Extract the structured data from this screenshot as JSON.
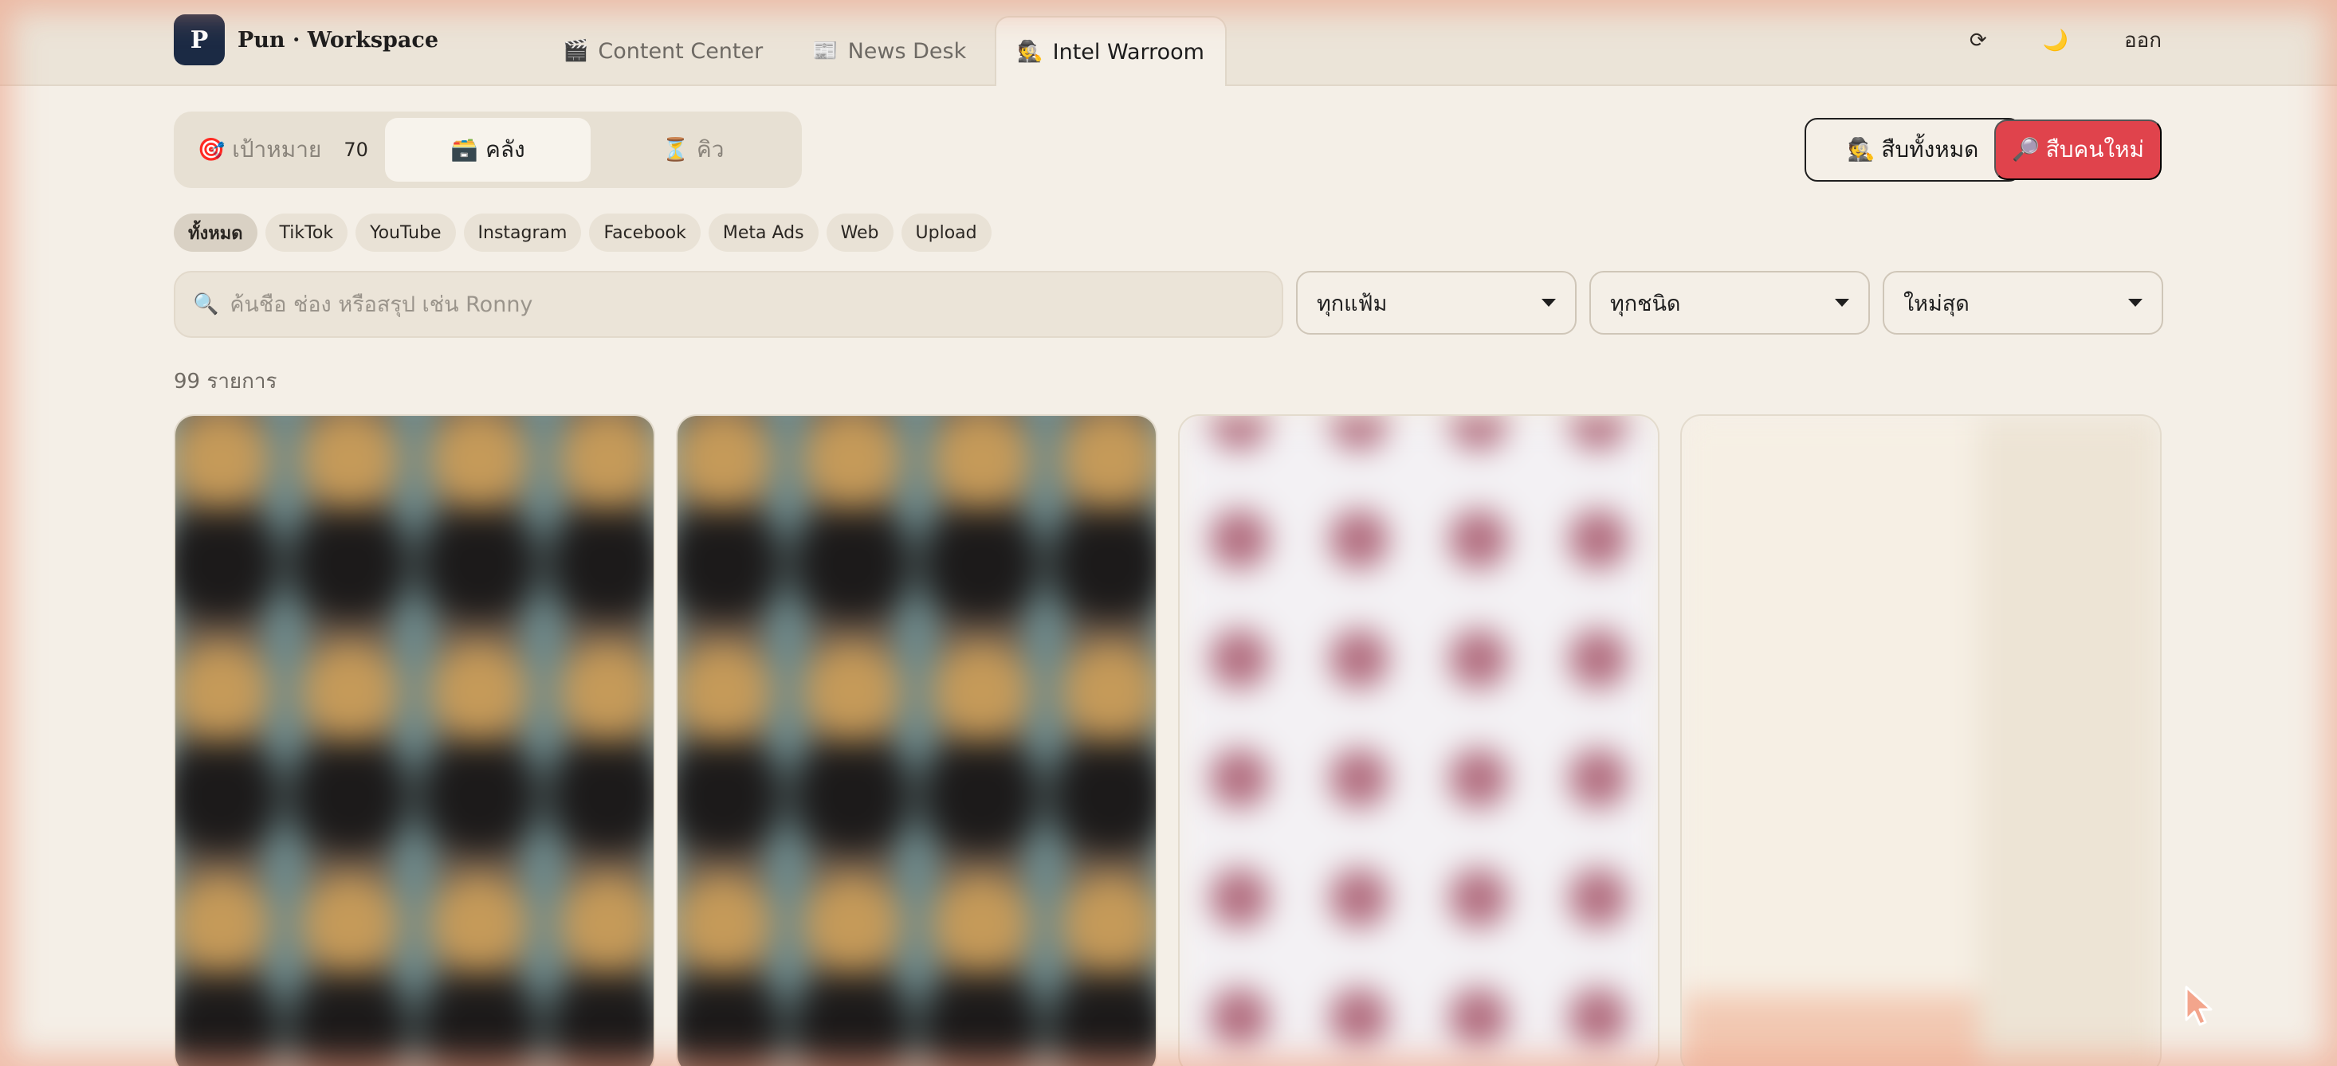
{
  "brand": {
    "logo_letter": "P",
    "name": "Pun · Workspace"
  },
  "nav": {
    "tabs": [
      {
        "icon": "🎬",
        "label": "Content Center",
        "active": false
      },
      {
        "icon": "📰",
        "label": "News Desk",
        "active": false
      },
      {
        "icon": "🕵️",
        "label": "Intel Warroom",
        "active": true
      }
    ]
  },
  "header_actions": {
    "refresh": "⟳",
    "theme": "🌙",
    "logout": "ออก"
  },
  "segment": {
    "target_label": "🎯 เป้าหมาย",
    "target_count": "70",
    "library_label": "🗃️ คลัง",
    "queue_label": "⏳ คิว"
  },
  "buttons": {
    "investigate_all": "🕵️ สืบทั้งหมด",
    "investigate_new": "🔎 สืบคนใหม่"
  },
  "chips": [
    "ทั้งหมด",
    "TikTok",
    "YouTube",
    "Instagram",
    "Facebook",
    "Meta Ads",
    "Web",
    "Upload"
  ],
  "search": {
    "placeholder": "ค้นชื่อ ช่อง หรือสรุป เช่น Ronny",
    "value": ""
  },
  "filters": {
    "folder": "ทุกแฟ้ม",
    "type": "ทุกชนิด",
    "sort": "ใหม่สุด"
  },
  "result_count": "99 รายการ",
  "colors": {
    "accent_red": "#e0434c",
    "brand_navy": "#1b2a44",
    "background": "#f4efe7"
  }
}
